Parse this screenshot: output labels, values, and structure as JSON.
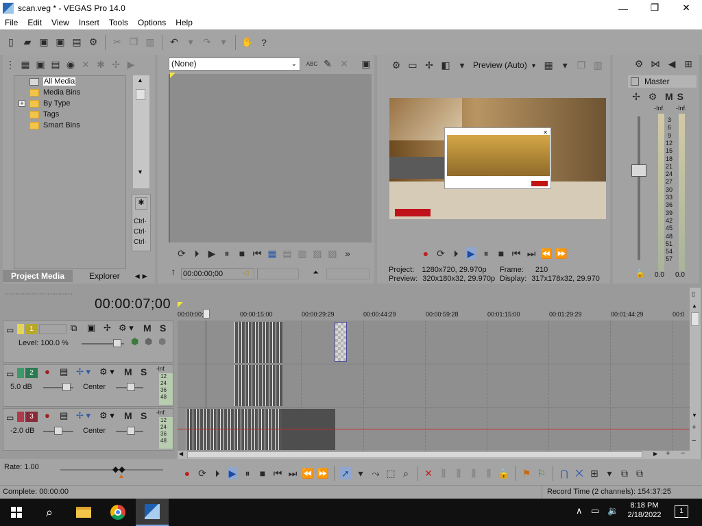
{
  "window": {
    "title": "scan.veg * - VEGAS Pro 14.0",
    "minimize": "—",
    "maximize": "❐",
    "close": "✕"
  },
  "menu": [
    "File",
    "Edit",
    "View",
    "Insert",
    "Tools",
    "Options",
    "Help"
  ],
  "media": {
    "tree": [
      "All Media",
      "Media Bins",
      "By Type",
      "Tags",
      "Smart Bins"
    ],
    "expander": "+",
    "tabs": [
      "Project Media",
      "Explorer"
    ],
    "ctrl": [
      "Ctrl·",
      "Ctrl·",
      "Ctrl·"
    ]
  },
  "trimmer": {
    "combo": "(None)",
    "abc": "ABC",
    "timecode": "00:00:00;00"
  },
  "preview": {
    "mode": "Preview (Auto)",
    "project_label": "Project:",
    "project_value": "1280x720, 29.970p",
    "frame_label": "Frame:",
    "frame_value": "210",
    "preview_label": "Preview:",
    "preview_value": "320x180x32, 29.970p",
    "display_label": "Display:",
    "display_value": "317x178x32, 29.970"
  },
  "mixer": {
    "title": "Master",
    "m": "M",
    "s": "S",
    "inf_left": "-Inf.",
    "inf_right": "-Inf.",
    "scale": [
      "3",
      "6",
      "9",
      "12",
      "15",
      "18",
      "21",
      "24",
      "27",
      "30",
      "33",
      "36",
      "39",
      "42",
      "45",
      "48",
      "51",
      "54",
      "57"
    ],
    "bottom_left": "0.0",
    "bottom_right": "0.0"
  },
  "timeline": {
    "timecode": "00:00:07;00",
    "ruler": [
      "00:00:00;00",
      "00:00:15:00",
      "00:00:29:29",
      "00:00:44:29",
      "00:00:59:28",
      "00:01:15:00",
      "00:01:29:29",
      "00:01:44:29",
      "00:0"
    ]
  },
  "tracks": [
    {
      "num": "1",
      "level_label": "Level: 100.0 %",
      "m": "M",
      "s": "S",
      "color": "#e3d45a"
    },
    {
      "num": "2",
      "db": "5.0 dB",
      "pan": "Center",
      "m": "M",
      "s": "S",
      "inf": "-Inf.",
      "meter": "12 24 36 48",
      "color": "#3c9a6a"
    },
    {
      "num": "3",
      "db": "-2.0 dB",
      "pan": "Center",
      "m": "M",
      "s": "S",
      "inf": "-Inf.",
      "meter": "12 24 36 48",
      "color": "#b03a4a"
    }
  ],
  "transport": {
    "rate": "Rate: 1.00"
  },
  "status": {
    "complete": "Complete: 00:00:00",
    "record": "Record Time (2 channels): 154:37:25"
  },
  "taskbar": {
    "time": "8:18 PM",
    "date": "2/18/2022",
    "notif": "1"
  }
}
